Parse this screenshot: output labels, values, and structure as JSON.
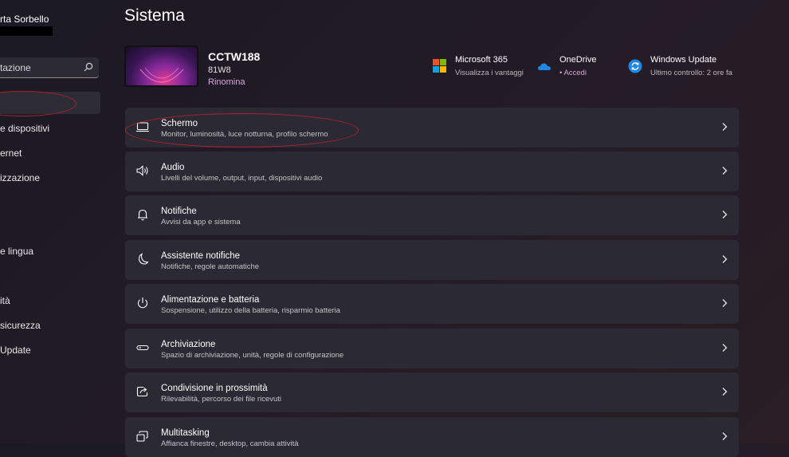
{
  "sidebar": {
    "user_name": "rta Sorbello",
    "search_placeholder": "tazione",
    "items": [
      {
        "label": "e dispositivi"
      },
      {
        "label": "ernet"
      },
      {
        "label": "izzazione"
      },
      {
        "label": "e lingua"
      },
      {
        "label": "ità"
      },
      {
        "label": "sicurezza"
      },
      {
        "label": "Update"
      }
    ]
  },
  "page": {
    "title": "Sistema"
  },
  "device": {
    "name": "CCTW188",
    "model": "81W8",
    "rename_label": "Rinomina"
  },
  "quick_links": [
    {
      "title": "Microsoft 365",
      "subtitle": "Visualizza i vantaggi",
      "icon": "microsoft-365-icon"
    },
    {
      "title": "OneDrive",
      "subtitle": "• Accedi",
      "icon": "onedrive-icon"
    },
    {
      "title": "Windows Update",
      "subtitle": "Ultimo controllo: 2 ore fa",
      "icon": "windows-update-icon"
    }
  ],
  "settings": [
    {
      "title": "Schermo",
      "subtitle": "Monitor, luminosità, luce notturna, profilo schermo",
      "icon": "monitor-icon"
    },
    {
      "title": "Audio",
      "subtitle": "Livelli del volume, output, input, dispositivi audio",
      "icon": "speaker-icon"
    },
    {
      "title": "Notifiche",
      "subtitle": "Avvisi da app e sistema",
      "icon": "bell-icon"
    },
    {
      "title": "Assistente notifiche",
      "subtitle": "Notifiche, regole automatiche",
      "icon": "moon-icon"
    },
    {
      "title": "Alimentazione e batteria",
      "subtitle": "Sospensione, utilizzo della batteria, risparmio batteria",
      "icon": "power-icon"
    },
    {
      "title": "Archiviazione",
      "subtitle": "Spazio di archiviazione, unità, regole di configurazione",
      "icon": "storage-icon"
    },
    {
      "title": "Condivisione in prossimità",
      "subtitle": "Rilevabilità, percorso dei file ricevuti",
      "icon": "share-icon"
    },
    {
      "title": "Multitasking",
      "subtitle": "Affianca finestre, desktop, cambia attività",
      "icon": "multitasking-icon"
    }
  ],
  "colors": {
    "accent": "#d9a6e2",
    "annotation": "#b0202c",
    "card": "#2b2933"
  }
}
